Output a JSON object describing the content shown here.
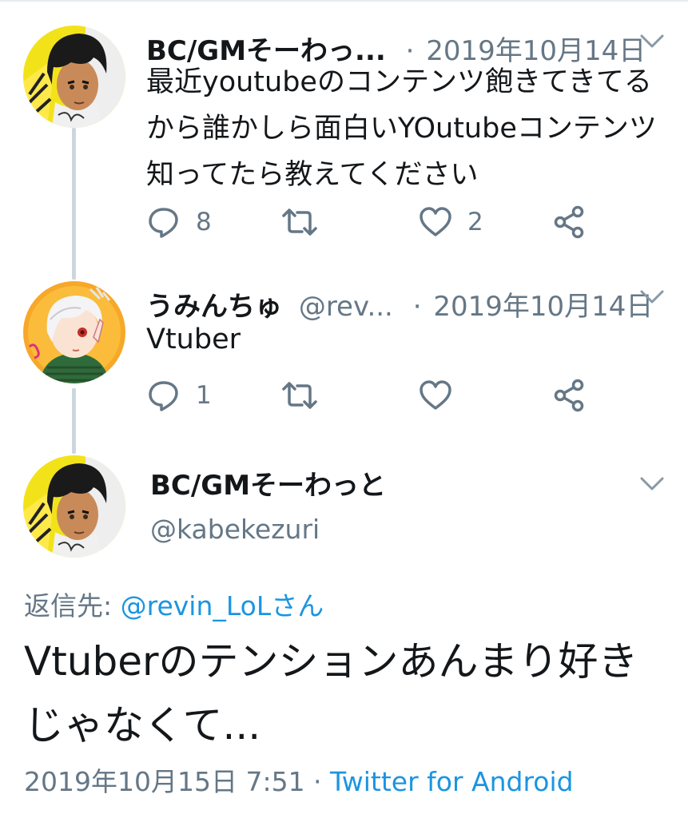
{
  "thread": [
    {
      "name": "BC/GMそーわっ...",
      "handle": "",
      "separator": "·",
      "date": "2019年10月14日",
      "text_lines": [
        "最近youtubeのコンテンツ飽きてきてる",
        "から誰かしら面白いYOutubeコンテンツ",
        "知ってたら教えてください"
      ],
      "reply_count": "8",
      "retweet_count": "",
      "like_count": "2"
    },
    {
      "name": "うみんちゅ",
      "handle": "@rev...",
      "separator": "·",
      "date": "2019年10月14日",
      "text_lines": [
        "Vtuber"
      ],
      "reply_count": "1",
      "retweet_count": "",
      "like_count": ""
    }
  ],
  "focus": {
    "name": "BC/GMそーわっと",
    "handle": "@kabekezuri",
    "reply_prefix": "返信先: ",
    "reply_to": "@revin_LoLさん",
    "text_lines": [
      "Vtuberのテンションあんまり好き",
      "じゃなくて..."
    ],
    "timestamp": "2019年10月15日 7:51",
    "meta_separator": " · ",
    "source": "Twitter for Android"
  },
  "icons": {
    "reply": "reply-bubble-icon",
    "retweet": "retweet-arrows-icon",
    "like": "heart-icon",
    "share": "share-nodes-icon",
    "chevron": "chevron-down-icon"
  },
  "colors": {
    "text": "#14171a",
    "secondary": "#657786",
    "link": "#1b95e0",
    "thread_line": "#ccd6dd",
    "icon": "#657786"
  }
}
